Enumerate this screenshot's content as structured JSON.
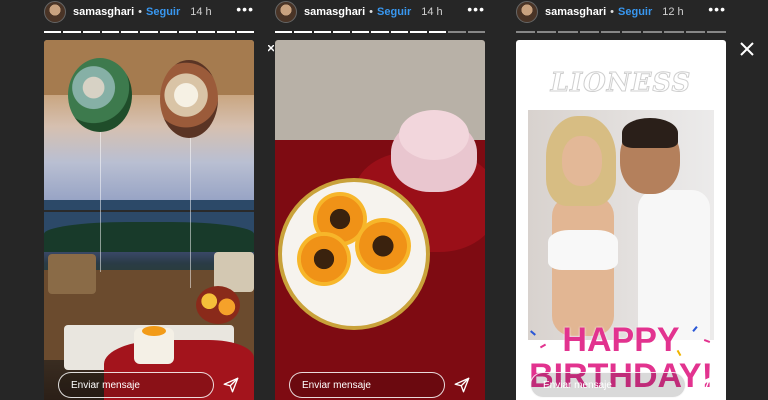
{
  "stories": [
    {
      "username": "samasghari",
      "follow_label": "Seguir",
      "time": "14 h",
      "reply_placeholder": "Enviar mensaje",
      "progress_segments": 11,
      "progress_done": 11
    },
    {
      "username": "samasghari",
      "follow_label": "Seguir",
      "time": "14 h",
      "reply_placeholder": "Enviar mensaje",
      "progress_segments": 11,
      "progress_done": 9
    },
    {
      "username": "samasghari",
      "follow_label": "Seguir",
      "time": "12 h",
      "reply_placeholder": "Enviar mensaje",
      "progress_segments": 10,
      "progress_done": 0,
      "sticker_top": "LIONESS",
      "sticker_bottom_line1": "HAPPY",
      "sticker_bottom_line2": "BIRTHDAY!"
    }
  ],
  "icons": {
    "more": "more-options-icon",
    "send": "send-icon",
    "close": "close-icon"
  },
  "colors": {
    "background": "#262626",
    "follow_blue": "#3897f0",
    "birthday_pink": "#e2338f"
  }
}
